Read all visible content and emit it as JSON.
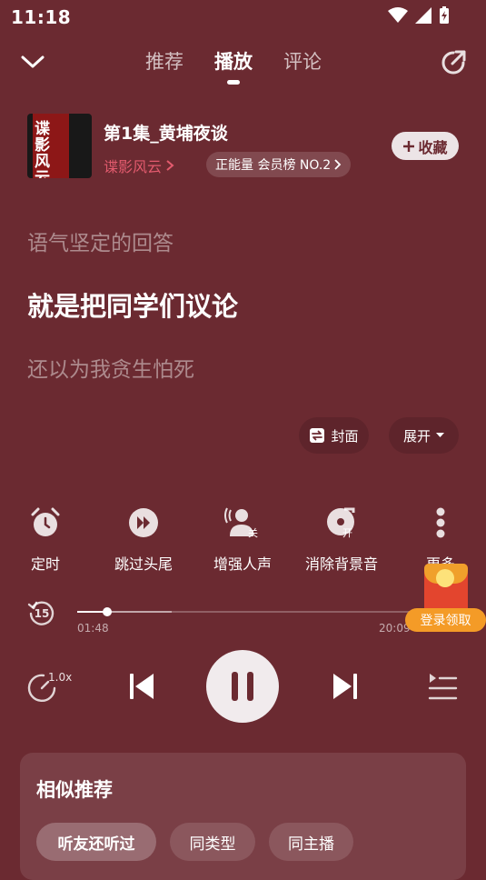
{
  "status_bar": {
    "time": "11:18"
  },
  "header": {
    "tabs": [
      {
        "label": "推荐"
      },
      {
        "label": "播放"
      },
      {
        "label": "评论"
      }
    ],
    "active_tab": "播放"
  },
  "episode": {
    "cover_text": "谍影风云",
    "title": "第1集_黄埔夜谈",
    "author": "谍影风云",
    "rank_badge": "正能量 会员榜 NO.2",
    "favorite_label": "收藏"
  },
  "lyrics": {
    "previous": "语气坚定的回答",
    "current": "就是把同学们议论",
    "next": "还以为我贪生怕死"
  },
  "view_options": {
    "cover_label": "封面",
    "expand_label": "展开"
  },
  "functions": [
    {
      "label": "定时",
      "icon": "alarm-clock-icon"
    },
    {
      "label": "跳过头尾",
      "icon": "skip-forward-icon"
    },
    {
      "label": "增强人声",
      "icon": "voice-enhance-icon",
      "state": "关"
    },
    {
      "label": "消除背景音",
      "icon": "music-disc-icon",
      "state": "开"
    },
    {
      "label": "更多",
      "icon": "more-vertical-icon"
    }
  ],
  "progress": {
    "rewind_seconds": "15",
    "current_time": "01:48",
    "total_time": "20:09",
    "played_fraction": 0.089,
    "buffered_fraction": 0.28
  },
  "promo": {
    "label": "登录领取"
  },
  "playback": {
    "speed": "1.0x",
    "state": "playing"
  },
  "recommend": {
    "title": "相似推荐",
    "chips": [
      {
        "label": "听友还听过",
        "active": true
      },
      {
        "label": "同类型",
        "active": false
      },
      {
        "label": "同主播",
        "active": false
      }
    ]
  },
  "colors": {
    "background": "#6b2a31",
    "accent_author": "#e35b6e",
    "promo": "#f49b27"
  }
}
